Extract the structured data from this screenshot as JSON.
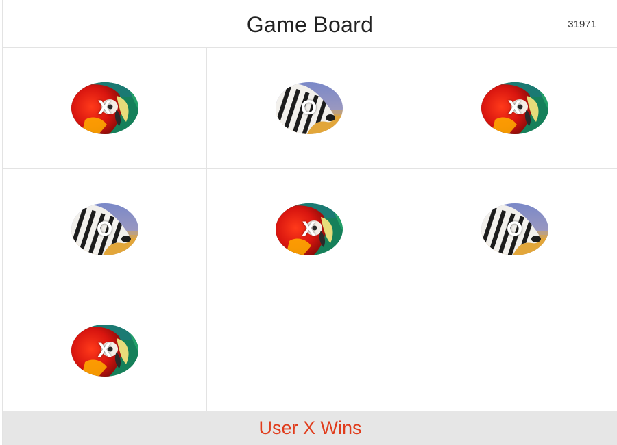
{
  "header": {
    "title": "Game Board",
    "game_id": "31971"
  },
  "board": {
    "cells": [
      {
        "mark": "X",
        "image": "parrot-icon"
      },
      {
        "mark": "O",
        "image": "zebra-icon"
      },
      {
        "mark": "X",
        "image": "parrot-icon"
      },
      {
        "mark": "O",
        "image": "zebra-icon"
      },
      {
        "mark": "X",
        "image": "parrot-icon"
      },
      {
        "mark": "O",
        "image": "zebra-icon"
      },
      {
        "mark": "X",
        "image": "parrot-icon"
      },
      {
        "mark": "",
        "image": ""
      },
      {
        "mark": "",
        "image": ""
      }
    ]
  },
  "status": {
    "text": "User X Wins",
    "color": "#e03c1c"
  }
}
